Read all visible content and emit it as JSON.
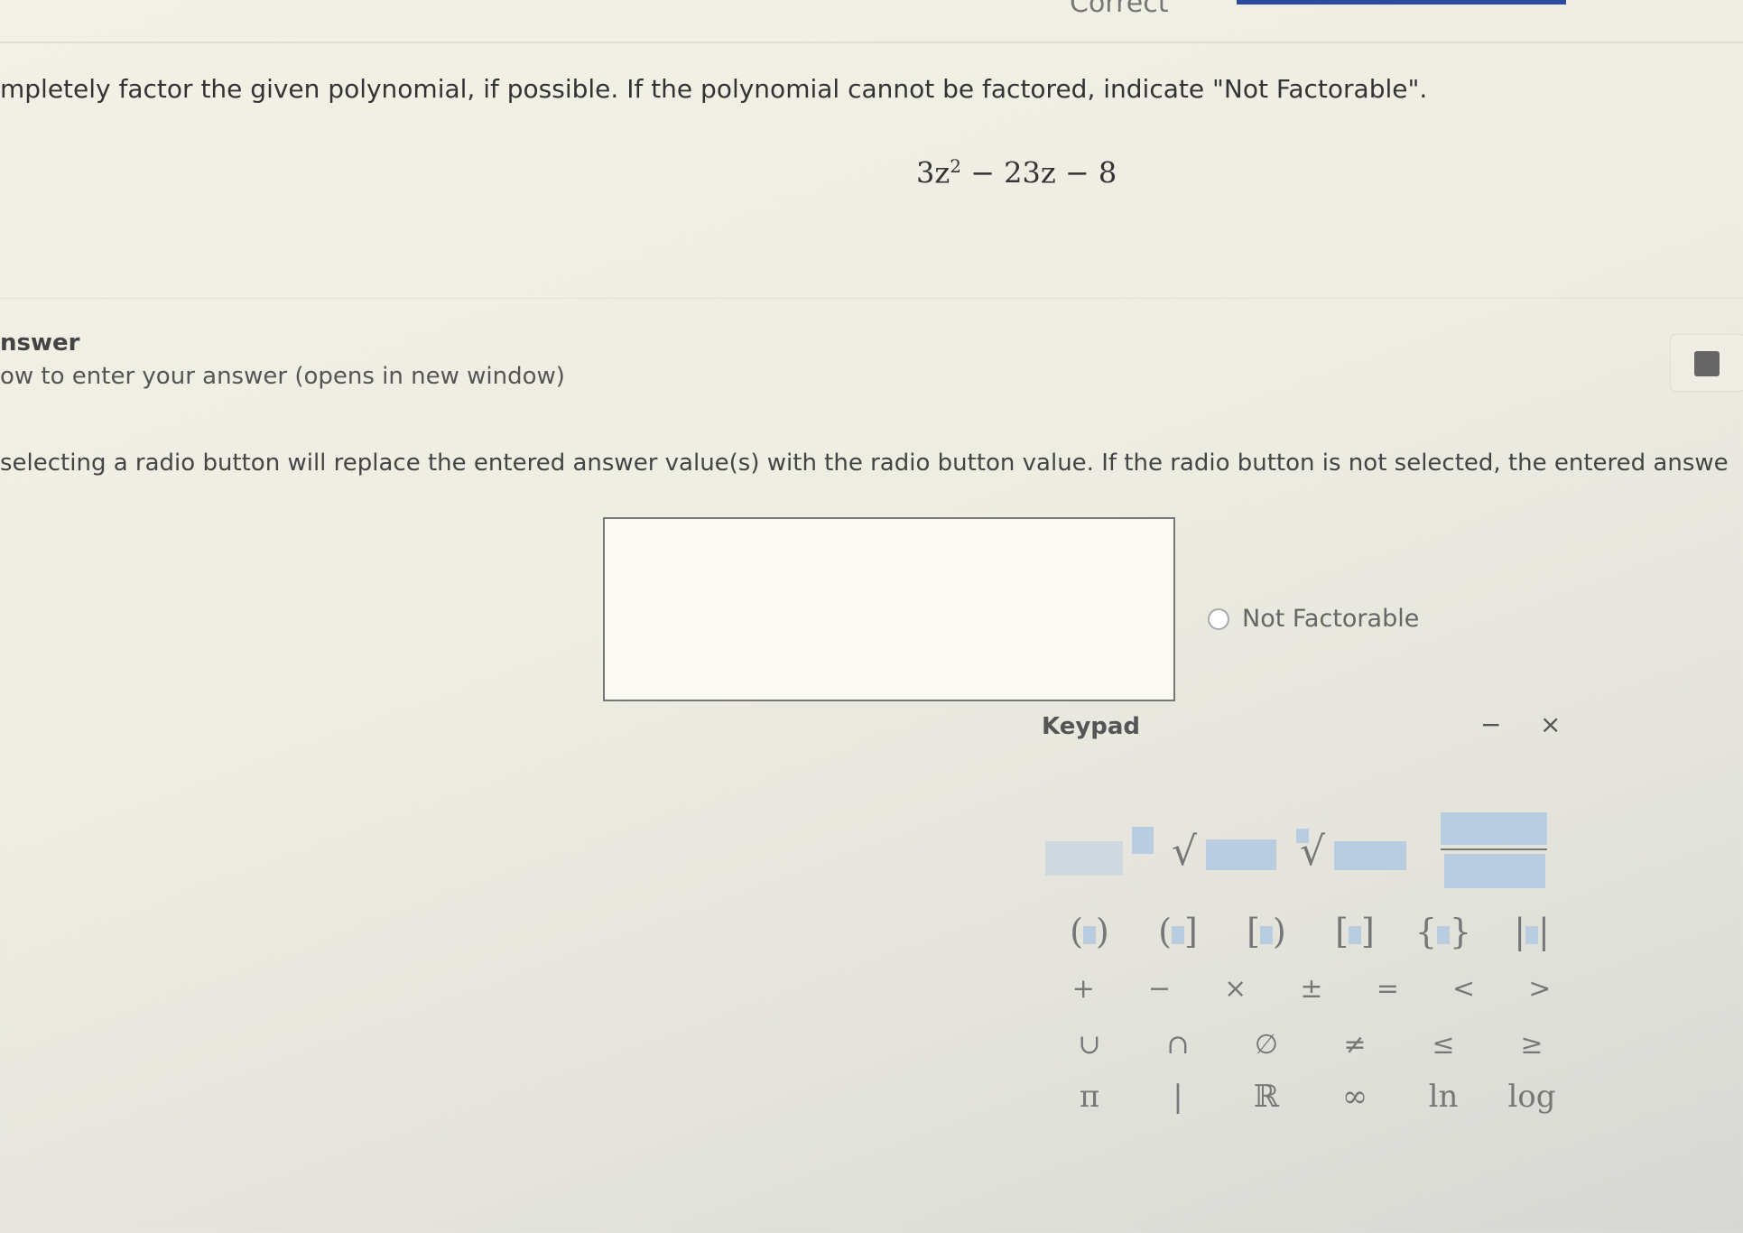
{
  "header": {
    "status": "Correct"
  },
  "question": {
    "prompt": "mpletely factor the given polynomial, if possible. If the polynomial cannot be factored, indicate \"Not Factorable\".",
    "polynomial": {
      "a": "3z",
      "exp": "2",
      "rest": " − 23z − 8"
    }
  },
  "answer": {
    "heading": "nswer",
    "help_link": "ow to enter your answer (opens in new window)",
    "instruction": "selecting a radio button will replace the entered answer value(s) with the radio button value. If the radio button is not selected, the entered answe",
    "input_value": "",
    "radio_label": "Not Factorable"
  },
  "keypad": {
    "title": "Keypad",
    "minimize": "−",
    "close": "×",
    "row_ops": [
      "+",
      "−",
      "×",
      "±",
      "=",
      "<",
      ">"
    ],
    "row_sets": [
      "∪",
      "∩",
      "∅",
      "≠",
      "≤",
      "≥"
    ],
    "row_const": [
      "π",
      "|",
      "ℝ",
      "∞",
      "ln",
      "log"
    ]
  }
}
